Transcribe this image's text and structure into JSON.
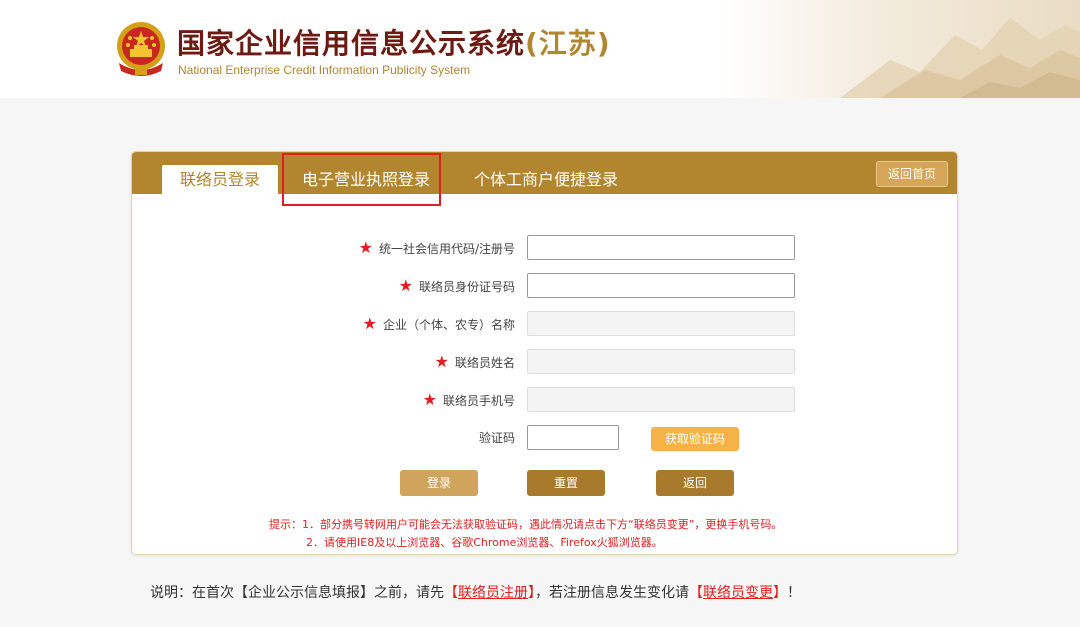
{
  "header": {
    "title_main": "国家企业信用信息公示系统",
    "title_province": "(江苏)",
    "subtitle": "National Enterprise Credit Information Publicity System"
  },
  "tabs": [
    {
      "label": "联络员登录",
      "active": true
    },
    {
      "label": "电子营业执照登录",
      "active": false,
      "highlighted": true
    },
    {
      "label": "个体工商户便捷登录",
      "active": false
    }
  ],
  "home_button": "返回首页",
  "form": {
    "fields": [
      {
        "label": "统一社会信用代码/注册号",
        "required": true,
        "value": "",
        "enabled": true
      },
      {
        "label": "联络员身份证号码",
        "required": true,
        "value": "",
        "enabled": true
      },
      {
        "label": "企业（个体、农专）名称",
        "required": true,
        "value": "",
        "enabled": false
      },
      {
        "label": "联络员姓名",
        "required": true,
        "value": "",
        "enabled": false
      },
      {
        "label": "联络员手机号",
        "required": true,
        "value": "",
        "enabled": false
      }
    ],
    "captcha_label": "验证码",
    "captcha_value": "",
    "get_code_button": "获取验证码",
    "buttons": {
      "login": "登录",
      "reset": "重置",
      "back": "返回"
    },
    "required_mark": "★"
  },
  "tips": {
    "line1": "提示：1．部分携号转网用户可能会无法获取验证码，遇此情况请点击下方“联络员变更”，更换手机号码。",
    "line2": "2．请使用IE8及以上浏览器、谷歌Chrome浏览器、Firefox火狐浏览器。"
  },
  "note": {
    "prefix": "说明：在首次【企业公示信息填报】之前，请先",
    "link1": "联络员注册",
    "middle": "，若注册信息发生变化请",
    "link2": "联络员变更",
    "suffix": "！"
  },
  "colors": {
    "brand": "#b2852f",
    "title": "#6d1a12",
    "required": "#e02020"
  }
}
